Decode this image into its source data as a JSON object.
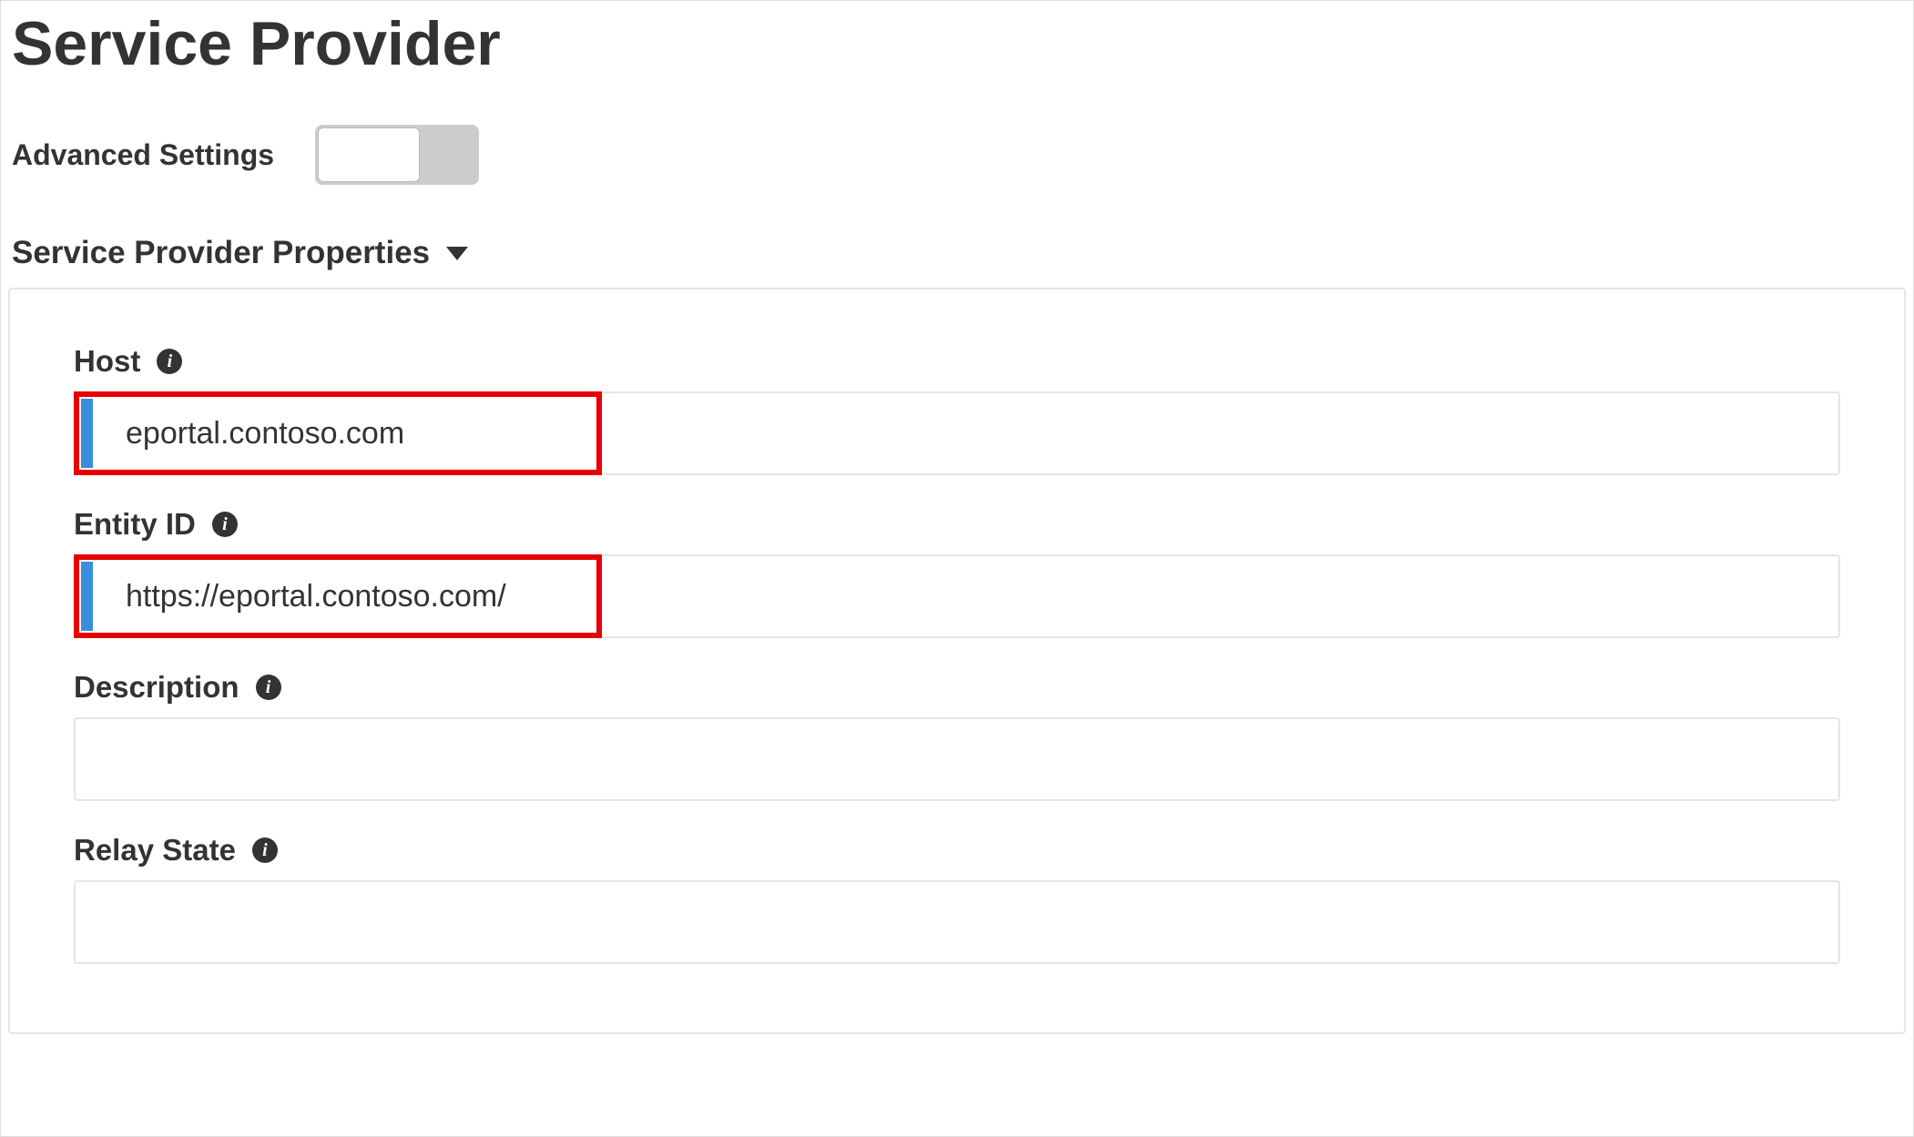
{
  "page": {
    "title": "Service Provider"
  },
  "advanced_settings": {
    "label": "Advanced Settings",
    "enabled": false
  },
  "section": {
    "title": "Service Provider Properties"
  },
  "fields": {
    "host": {
      "label": "Host",
      "value": "eportal.contoso.com",
      "highlighted": true
    },
    "entity_id": {
      "label": "Entity ID",
      "value": "https://eportal.contoso.com/",
      "highlighted": true
    },
    "description": {
      "label": "Description",
      "value": ""
    },
    "relay_state": {
      "label": "Relay State",
      "value": ""
    }
  }
}
